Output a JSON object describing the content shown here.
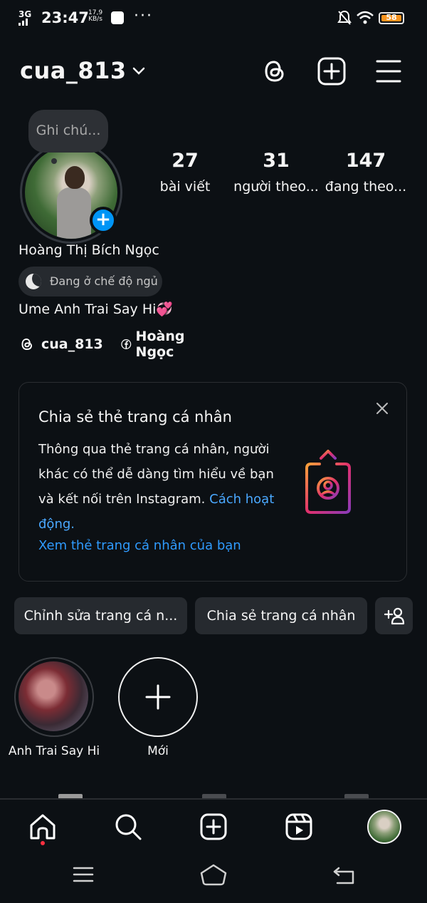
{
  "status_bar": {
    "network": "3G",
    "time": "23:47",
    "speed_value": "17,9",
    "speed_unit": "KB/s",
    "more": "···",
    "battery": "58"
  },
  "header": {
    "username": "cua_813",
    "icons": [
      "chevron-down-icon",
      "threads-icon",
      "create-post-icon",
      "menu-icon"
    ]
  },
  "profile": {
    "note_placeholder": "Ghi chú...",
    "stats": [
      {
        "value": "27",
        "label": "bài viết"
      },
      {
        "value": "31",
        "label": "người theo..."
      },
      {
        "value": "147",
        "label": "đang theo..."
      }
    ],
    "name": "Hoàng Thị Bích Ngọc",
    "status": "Đang ở chế độ ngủ",
    "bio": "Ume Anh Trai Say Hi💞",
    "links": [
      {
        "icon": "threads-icon",
        "label": "cua_813"
      },
      {
        "icon": "facebook-icon",
        "label": "Hoàng Ngọc"
      }
    ]
  },
  "share_card": {
    "title": "Chia sẻ thẻ trang cá nhân",
    "description": "Thông qua thẻ trang cá nhân, người khác có thể dễ dàng tìm hiểu về bạn và kết nối trên Instagram.",
    "how_link": "Cách hoạt động.",
    "cta": "Xem thẻ trang cá nhân của bạn"
  },
  "actions": {
    "edit": "Chỉnh sửa trang cá n...",
    "share": "Chia sẻ trang cá nhân"
  },
  "highlights": [
    {
      "label": "Anh Trai Say Hi"
    },
    {
      "label": "Mới"
    }
  ],
  "colors": {
    "background": "#0c1014",
    "accent": "#0095f6",
    "link": "#2f9bff",
    "button": "#262a2f"
  }
}
